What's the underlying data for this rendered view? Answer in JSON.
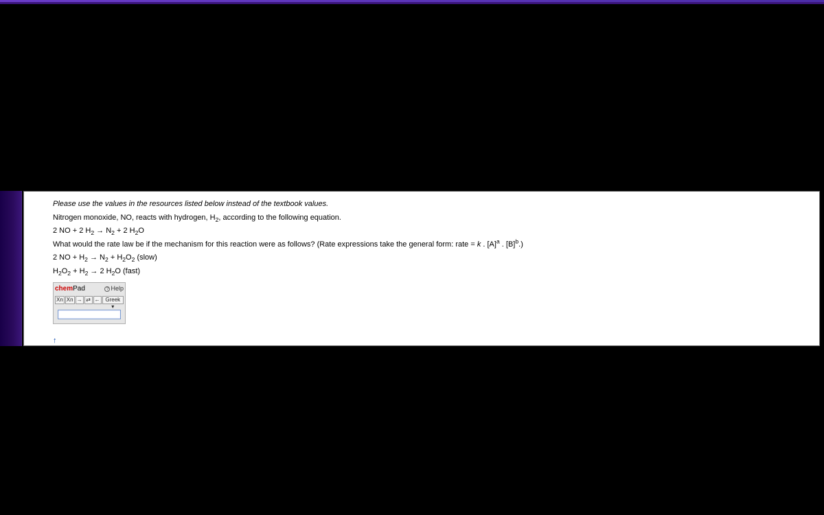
{
  "question": {
    "instruction": "Please use the values in the resources listed below instead of the textbook values.",
    "intro_prefix": "Nitrogen monoxide, NO, reacts with hydrogen, H",
    "intro_suffix": ", according to the following equation.",
    "equation_main_a": "2 NO + 2 H",
    "equation_main_b": " → N",
    "equation_main_c": " + 2 H",
    "equation_main_d": "O",
    "prompt_prefix": "What would the rate law be if the mechanism for this reaction were as follows? (Rate expressions take the general form: rate = ",
    "rate_k": "k",
    "rate_mid": " . [A]",
    "rate_mid2": " . [B]",
    "rate_suffix": ".)",
    "mech1_a": "2 NO + H",
    "mech1_b": " → N",
    "mech1_c": " + H",
    "mech1_d": "O",
    "mech1_note": " (slow)",
    "mech2_a": "H",
    "mech2_b": "O",
    "mech2_c": " + H",
    "mech2_d": " → 2 H",
    "mech2_e": "O",
    "mech2_note": " (fast)",
    "sub2": "2",
    "supa": "a",
    "supb": "b"
  },
  "chempad": {
    "brand_prefix": "chem",
    "brand_suffix": "Pad",
    "help_label": "Help",
    "btn_sub": "Xn",
    "btn_sup": "Xn",
    "btn_rarr": "→",
    "btn_rl": "⇄",
    "btn_larr": "←",
    "btn_greek": "Greek ▾"
  },
  "nav": {
    "up_arrow": "↑"
  }
}
